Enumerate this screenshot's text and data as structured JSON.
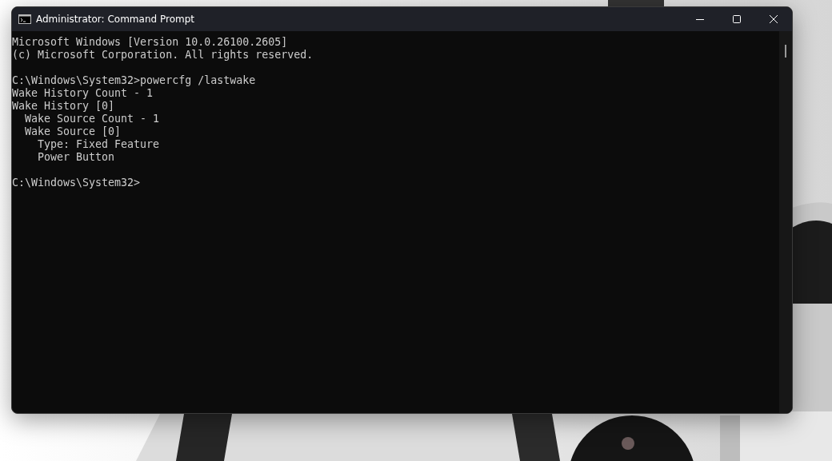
{
  "window": {
    "title": "Administrator: Command Prompt"
  },
  "console": {
    "blocks": [
      [
        "Microsoft Windows [Version 10.0.26100.2605]",
        "(c) Microsoft Corporation. All rights reserved."
      ],
      [
        "C:\\Windows\\System32>powercfg /lastwake",
        "Wake History Count - 1",
        "Wake History [0]",
        "  Wake Source Count - 1",
        "  Wake Source [0]",
        "    Type: Fixed Feature",
        "    Power Button"
      ],
      [
        "C:\\Windows\\System32>"
      ]
    ]
  }
}
